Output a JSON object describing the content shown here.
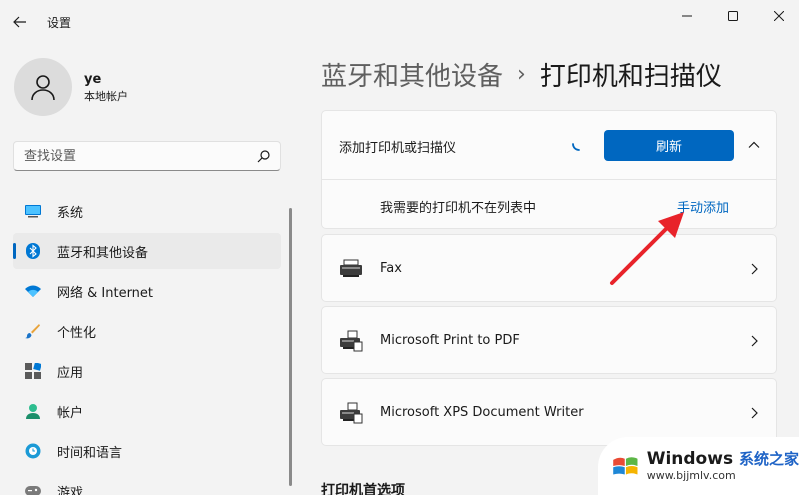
{
  "window": {
    "title": "设置"
  },
  "profile": {
    "name": "ye",
    "account_type": "本地帐户"
  },
  "search": {
    "placeholder": "查找设置"
  },
  "sidebar": {
    "items": [
      {
        "label": "系统",
        "icon": "monitor-icon"
      },
      {
        "label": "蓝牙和其他设备",
        "icon": "bluetooth-icon",
        "selected": true
      },
      {
        "label": "网络 & Internet",
        "icon": "wifi-icon"
      },
      {
        "label": "个性化",
        "icon": "brush-icon"
      },
      {
        "label": "应用",
        "icon": "apps-icon"
      },
      {
        "label": "帐户",
        "icon": "person-icon"
      },
      {
        "label": "时间和语言",
        "icon": "globe-clock-icon"
      },
      {
        "label": "游戏",
        "icon": "gamepad-icon"
      }
    ]
  },
  "breadcrumb": {
    "parent": "蓝牙和其他设备",
    "separator": "›",
    "current": "打印机和扫描仪"
  },
  "add_device": {
    "label": "添加打印机或扫描仪",
    "refresh_label": "刷新",
    "missing_label": "我需要的打印机不在列表中",
    "manual_add_label": "手动添加"
  },
  "printers": [
    {
      "name": "Fax"
    },
    {
      "name": "Microsoft Print to PDF"
    },
    {
      "name": "Microsoft XPS Document Writer"
    }
  ],
  "preferences_heading": "打印机首选项",
  "watermark": {
    "brand": "Windows",
    "brand_cn": "系统之家",
    "url": "www.bjjmlv.com"
  },
  "colors": {
    "accent": "#0067c0",
    "annotation_arrow": "#e8232a"
  }
}
